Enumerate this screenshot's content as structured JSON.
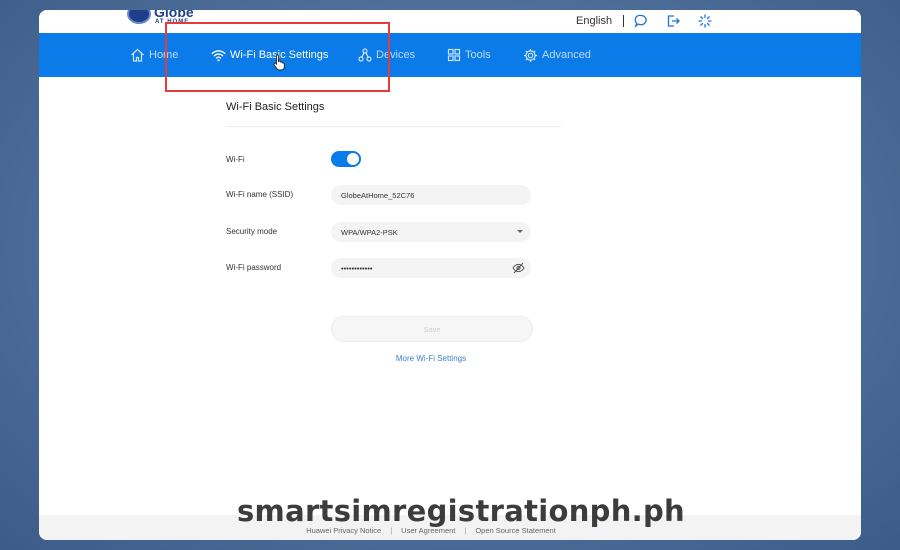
{
  "brand": {
    "name": "Globe",
    "sub": "AT HOME"
  },
  "topbar": {
    "language": "English",
    "icons": [
      "chat-icon",
      "logout-icon",
      "loading-icon"
    ]
  },
  "nav": {
    "home": "Home",
    "wifi": "Wi-Fi Basic Settings",
    "devices": "Devices",
    "tools": "Tools",
    "advanced": "Advanced"
  },
  "main": {
    "title": "Wi-Fi Basic Settings",
    "wifi_label": "Wi-Fi",
    "wifi_enabled": true,
    "ssid_label": "Wi-Fi name (SSID)",
    "ssid_value": "GlobeAtHome_52C76",
    "security_label": "Security mode",
    "security_value": "WPA/WPA2-PSK",
    "password_label": "Wi-Fi password",
    "password_value": "••••••••••••",
    "save": "Save",
    "more_link": "More Wi-Fi Settings"
  },
  "footer": {
    "privacy": "Huawei Privacy Notice",
    "agreement": "User Agreement",
    "open_source": "Open Source Statement"
  },
  "watermark": "smartsimregistrationph.ph",
  "colors": {
    "nav": "#0a7be8",
    "highlight": "#e63b3b",
    "link": "#3b7fd1"
  }
}
